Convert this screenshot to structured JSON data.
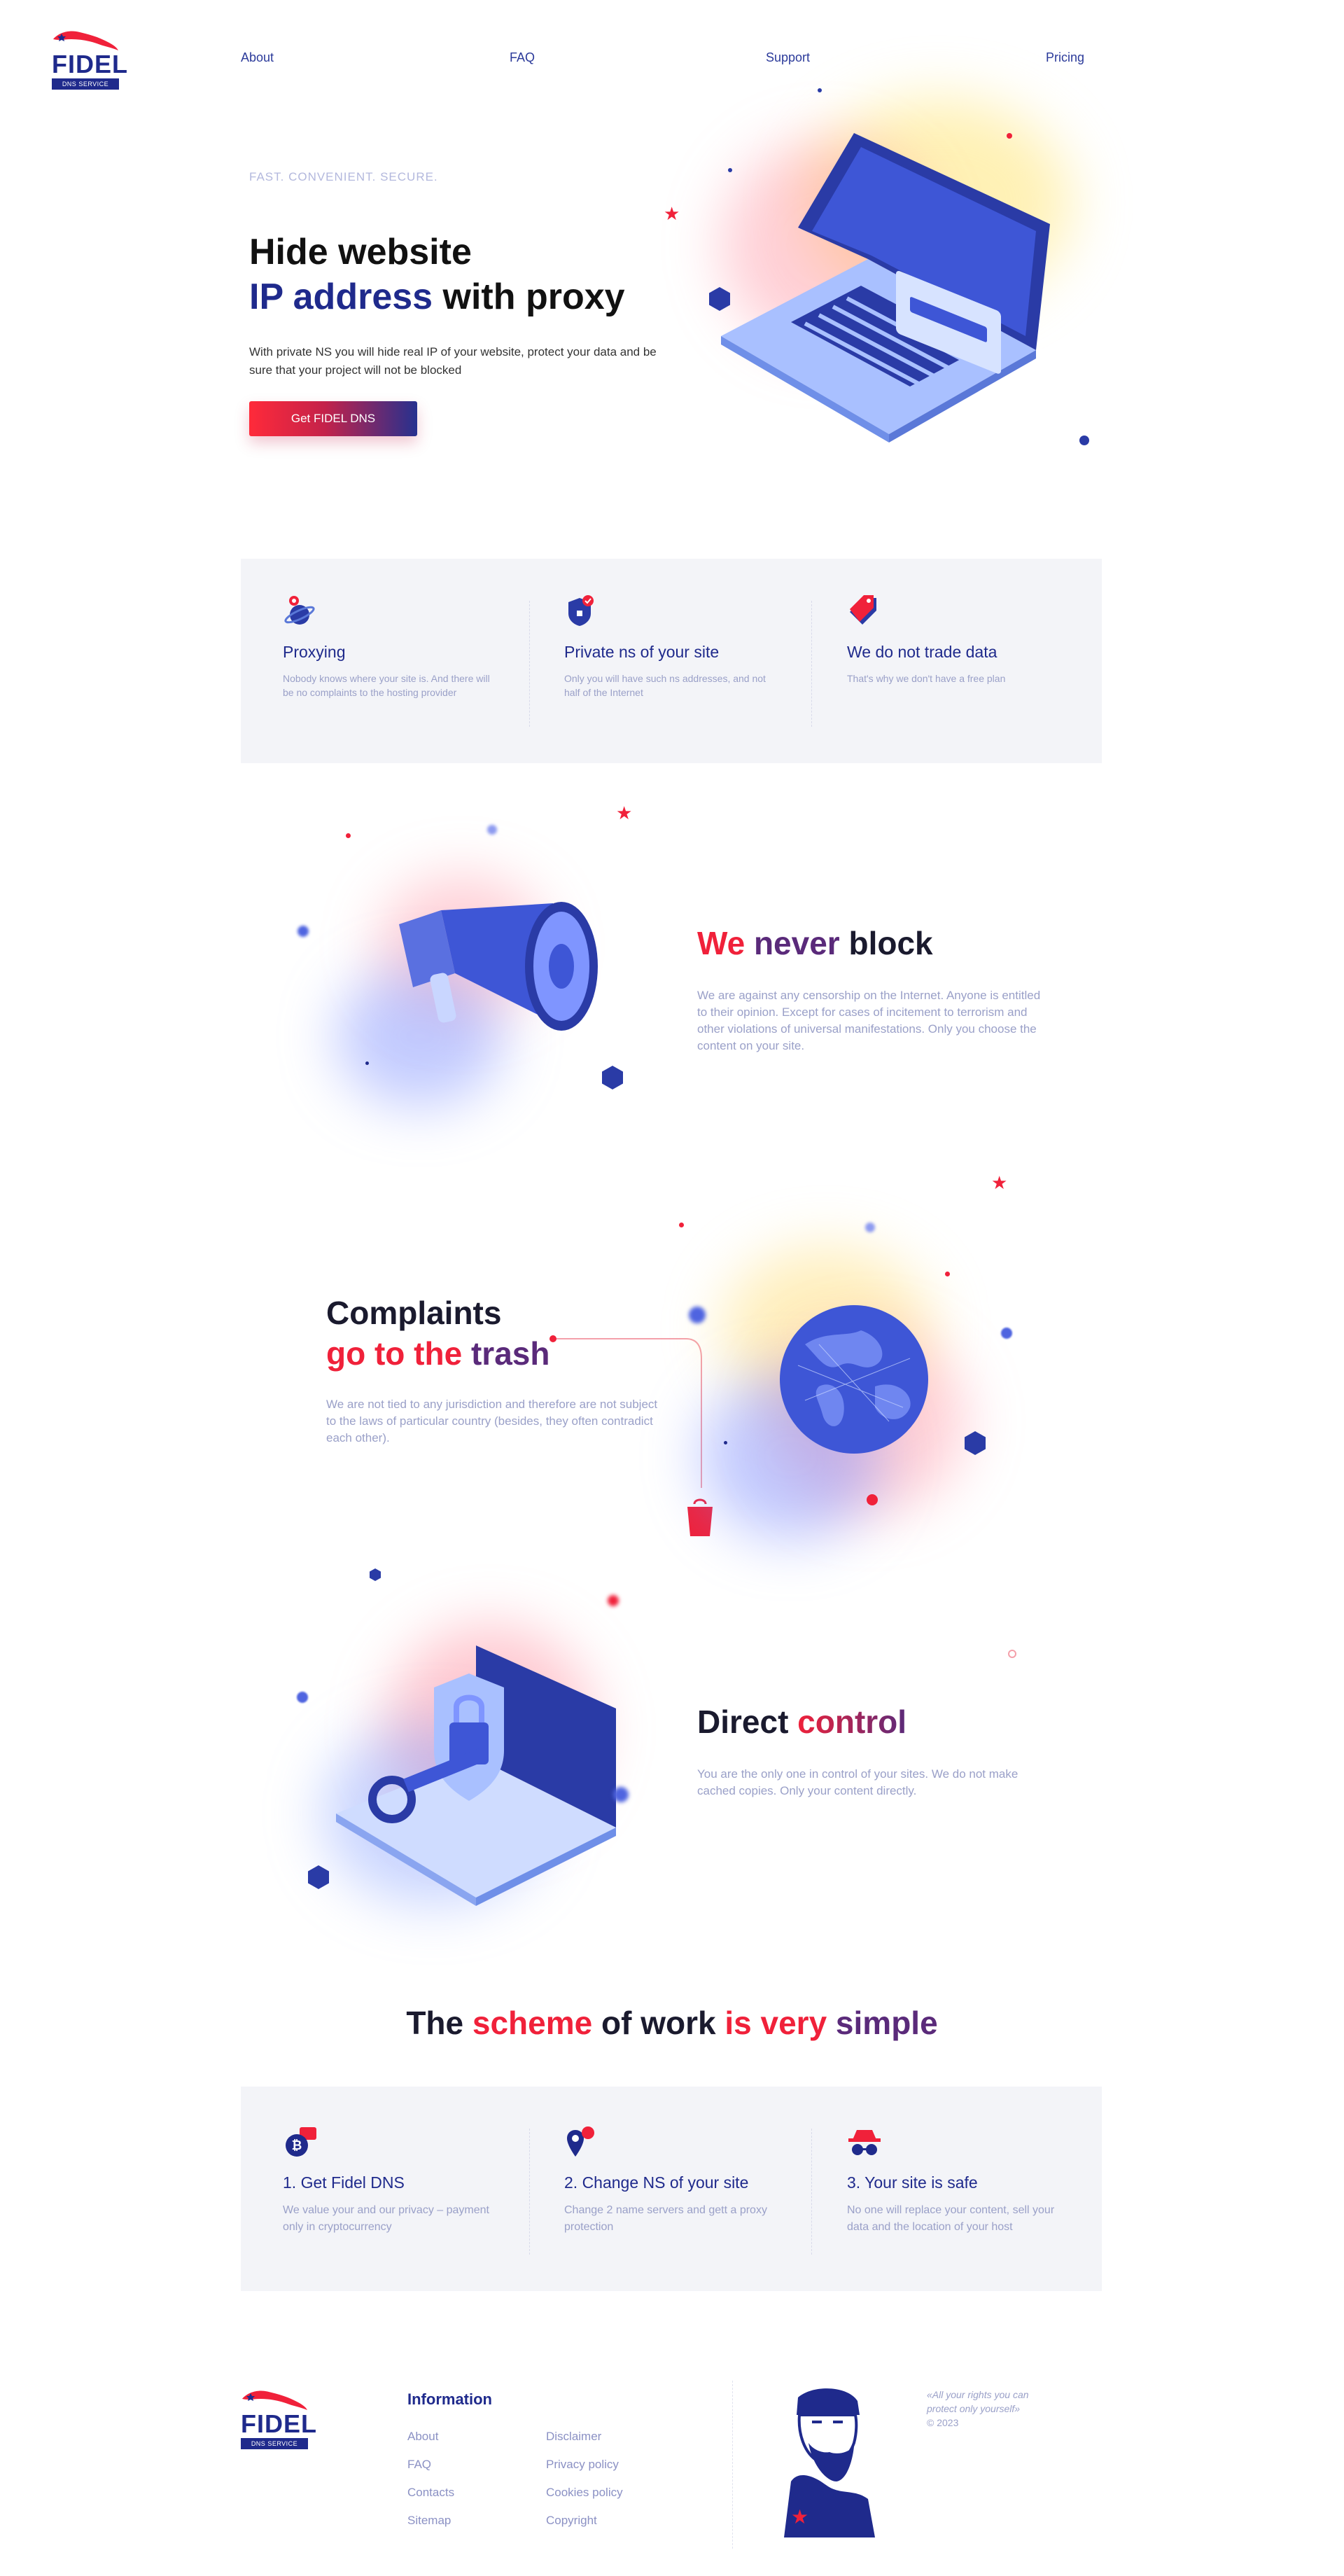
{
  "brand": {
    "name": "FIDEL",
    "tagline": "DNS SERVICE"
  },
  "nav": [
    "About",
    "FAQ",
    "Support",
    "Pricing"
  ],
  "hero": {
    "eyebrow": "FAST. CONVENIENT. SECURE.",
    "title_line1": "Hide website",
    "title_line2_a": "IP address",
    "title_line2_b": " with proxy",
    "desc": "With private NS you will hide real IP of your website, protect your data and be sure that your project will not be blocked",
    "cta": "Get FIDEL DNS"
  },
  "features": [
    {
      "icon": "planet-pin-icon",
      "title": "Proxying",
      "desc": "Nobody knows where your site is. And there will be no complaints to the hosting provider"
    },
    {
      "icon": "shield-lock-icon",
      "title": "Private ns of your site",
      "desc": "Only you will have such ns addresses, and not half of the Internet"
    },
    {
      "icon": "price-tag-icon",
      "title": "We do not trade data",
      "desc": "That's why we don't have a free plan"
    }
  ],
  "block": {
    "title_a": "We never",
    "title_b": " block",
    "title_a_red": "We",
    "title_a_plum": " never",
    "desc": "We are against any censorship on the Internet. Anyone is entitled to their opinion. Except for cases of incitement to terrorism and other violations of universal manifestations. Only you choose the content on your site."
  },
  "complaints": {
    "title_line1": "Complaints",
    "title_line2": "go to the trash",
    "title_line2_a": "go to the",
    "title_line2_b": " trash",
    "desc": "We are not tied to any jurisdiction and therefore are not subject to the laws of particular country (besides, they often contradict each other)."
  },
  "control": {
    "title_a": "Direct ",
    "title_b": "control",
    "desc": "You are the only one in control of your sites. We do not make cached copies. Only your content directly."
  },
  "scheme": {
    "t1": "The ",
    "t2": "scheme",
    "t3": " of work ",
    "t4": "is very",
    "t5": " simple"
  },
  "steps": [
    {
      "icon": "bitcoin-card-icon",
      "title": "1. Get Fidel DNS",
      "desc": "We value your and our privacy – payment only in cryptocurrency"
    },
    {
      "icon": "map-pin-icon",
      "title": "2. Change NS of your site",
      "desc": "Change 2 name servers and gett a proxy protection"
    },
    {
      "icon": "spy-hat-glasses-icon",
      "title": "3. Your site is safe",
      "desc": "No one will replace your content, sell your data and the location of your host"
    }
  ],
  "footer": {
    "heading": "Information",
    "col1": [
      "About",
      "FAQ",
      "Contacts",
      "Sitemap"
    ],
    "col2": [
      "Disclaimer",
      "Privacy policy",
      "Cookies policy",
      "Copyright"
    ],
    "quote_line1": "«All your rights you can",
    "quote_line2": "protect only yourself»",
    "copyright": "© 2023"
  },
  "colors": {
    "navy": "#1f2a8c",
    "red": "#f0213a",
    "plum": "#5a2a7a",
    "panel": "#f3f4f8",
    "muted": "#9aa0c8"
  }
}
